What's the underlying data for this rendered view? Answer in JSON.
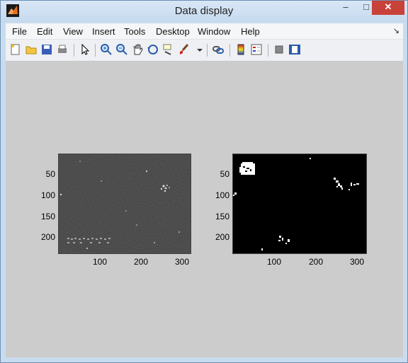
{
  "window": {
    "title": "Data display",
    "minimize": "–",
    "maximize": "□",
    "close": "✕"
  },
  "menu": [
    "File",
    "Edit",
    "View",
    "Insert",
    "Tools",
    "Desktop",
    "Window",
    "Help"
  ],
  "dock_glyph": "↘",
  "toolbar_icons": [
    "new-figure-icon",
    "open-icon",
    "save-icon",
    "print-icon",
    "pointer-icon",
    "zoom-in-icon",
    "zoom-out-icon",
    "pan-icon",
    "rotate-3d-icon",
    "data-cursor-icon",
    "brush-icon",
    "link-icon",
    "colorbar-icon",
    "legend-icon",
    "hide-plot-tools-icon",
    "show-plot-tools-icon"
  ],
  "axes": {
    "left": {
      "image": "grayscale noisy image",
      "yticks": [
        "50",
        "100",
        "150",
        "200"
      ],
      "xticks": [
        "100",
        "200",
        "300"
      ]
    },
    "right": {
      "image": "binary image",
      "yticks": [
        "50",
        "100",
        "150",
        "200"
      ],
      "xticks": [
        "100",
        "200",
        "300"
      ]
    }
  },
  "colors": {
    "title_bar": "#c9dcef",
    "close_button": "#c8423a",
    "figure_bg": "#cccccc",
    "axes_bg": "#000000"
  }
}
